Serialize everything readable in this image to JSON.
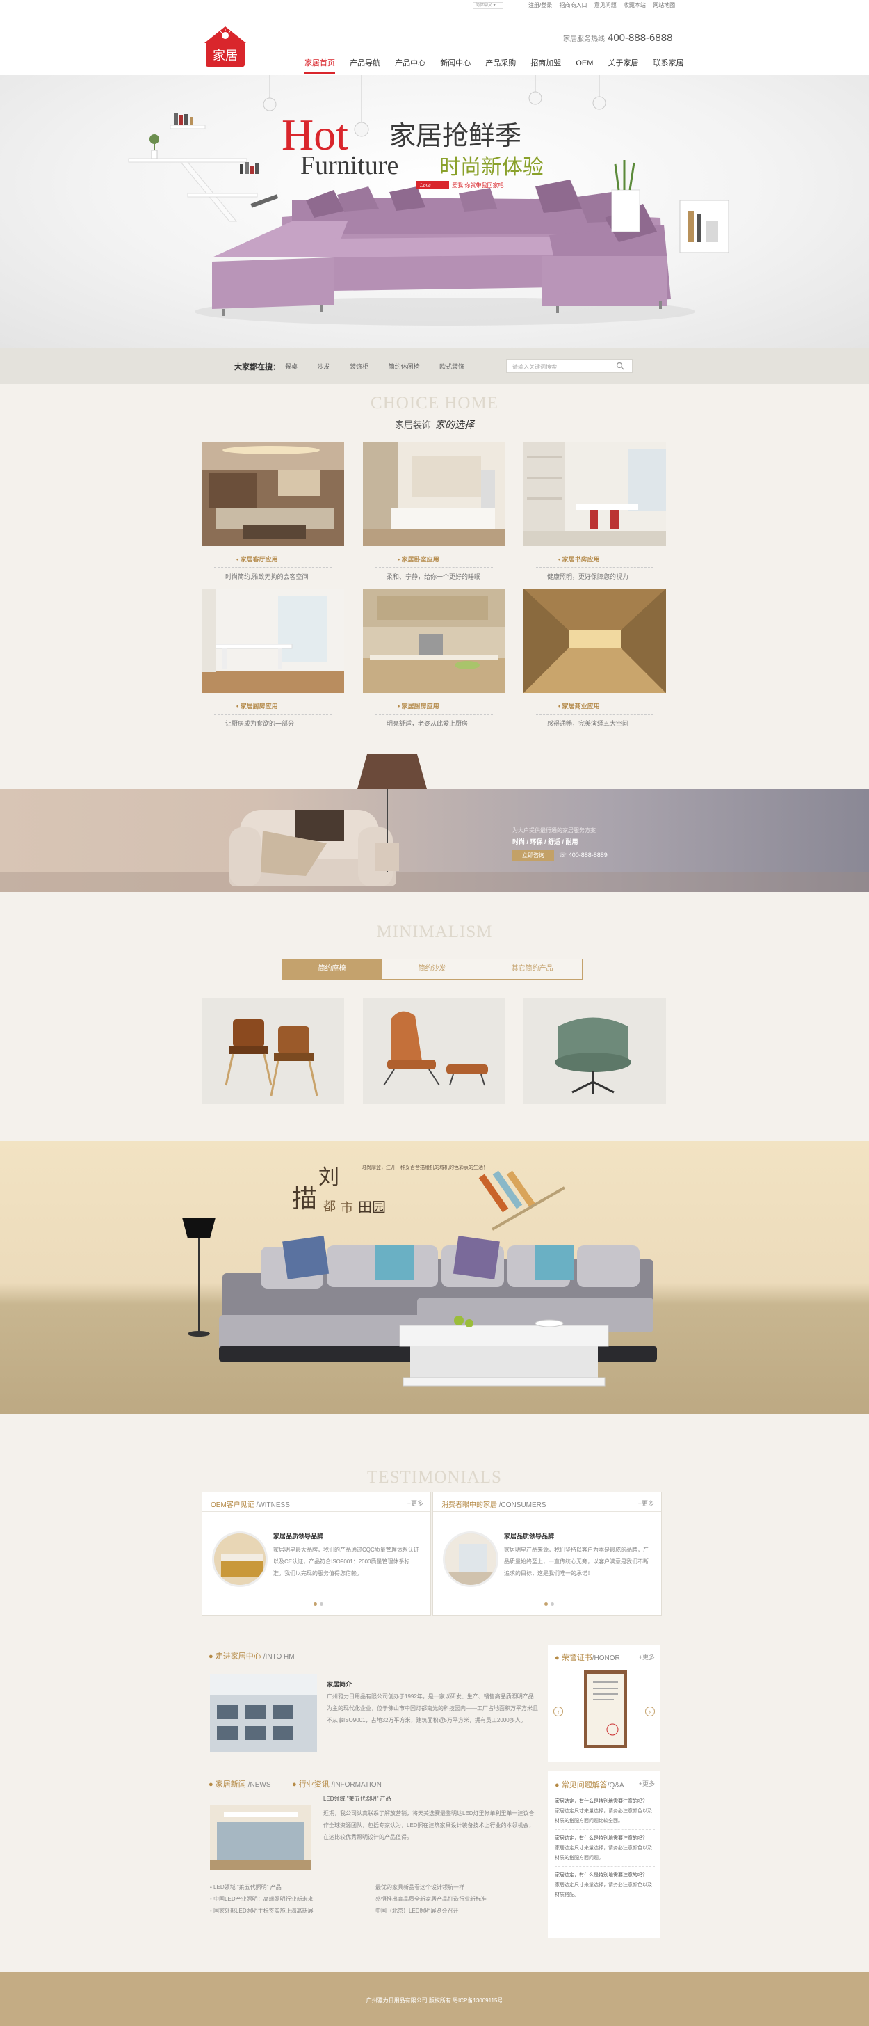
{
  "topbar": {
    "language": "简体中文 ▾",
    "links": [
      "注册/登录",
      "招商商入口",
      "意见问题",
      "收藏本站",
      "网站地图"
    ]
  },
  "header": {
    "logo_text": "家居",
    "hotline_label": "家居服务热线",
    "hotline_number": "400-888-6888",
    "nav": [
      "家居首页",
      "产品导航",
      "产品中心",
      "新闻中心",
      "产品采购",
      "招商加盟",
      "OEM",
      "关于家居",
      "联系家居"
    ]
  },
  "banner": {
    "hot": "Hot",
    "furniture": "Furniture",
    "title1": "家居抢鲜季",
    "title2": "时尚新体验",
    "tag_brand": "Love",
    "tag_text": "爱我 你就带我回家吧！"
  },
  "search": {
    "label": "大家都在搜：",
    "keywords": [
      "餐桌",
      "沙发",
      "装饰柜",
      "简约休闲椅",
      "欧式装饰"
    ],
    "placeholder": "请输入关键词搜索"
  },
  "choice": {
    "en": "CHOICE HOME",
    "cn": "家居装饰",
    "cn_script": "家的选择",
    "cards": [
      {
        "title": "家居客厅应用",
        "desc": "时尚简约,雅致无拘的会客空间"
      },
      {
        "title": "家居卧室应用",
        "desc": "柔和、宁静，给你一个更好的睡眠"
      },
      {
        "title": "家居书房应用",
        "desc": "健康照明，更好保障您的视力"
      },
      {
        "title": "家居厨房应用",
        "desc": "让厨房成为食欲的一部分"
      },
      {
        "title": "家居厨房应用",
        "desc": "明亮舒适，老婆从此爱上厨房"
      },
      {
        "title": "家居商业应用",
        "desc": "感得通畅，完美演绎五大空间"
      }
    ]
  },
  "strip": {
    "text": "为大户提供最行通的家居服务方案",
    "sub": "时尚 / 环保 / 舒适 / 耐用",
    "button": "立即咨询",
    "phone": "400-888-8889"
  },
  "minimal": {
    "en": "MINIMALISM",
    "tabs": [
      "简约座椅",
      "简约沙发",
      "其它简约产品"
    ]
  },
  "promo": {
    "char1": "描",
    "char2": "刘",
    "char3": "都",
    "char4": "市",
    "char5": "田园",
    "small": "时尚摩登，注开一种妥否合描绘机的城机的色彩表的生活！"
  },
  "testimonials": {
    "en": "TESTIMONIALS",
    "left": {
      "title": "OEM客户见证",
      "en": "/WITNESS",
      "more": "+更多",
      "item": "家居品质领导品牌",
      "text": "家居明星最大品牌，我们的产品通过CQC质量管理体系认证以及CE认证，产品符合ISO9001：2000质量管理体系标准。我们以完现的服务值得您信赖。"
    },
    "right": {
      "title": "消费者眼中的家居",
      "en": "/CONSUMERS",
      "more": "+更多",
      "item": "家居品质领导品牌",
      "text": "家居明星产品来源，我们坚持以客户为本是最成的品牌，产品质量始终至上，一直传统心无旁，以客户满意是我们不断追求的目标，这是我们唯一的承诺！"
    }
  },
  "into": {
    "title": "走进家居中心",
    "en": "/INTO HM",
    "subtitle": "家居简介",
    "text": "广州雅力日用品有限公司创办于1992年，是一家以研发、生产、销售高品质照明产品为主的现代化企业，位于佛山市中国灯都南光的科技园内——工厂占地面积万平方米且不从事ISO9001，占地32万平方米，建筑面积近5万平方米，拥有员工2000多人。"
  },
  "honor": {
    "title": "荣誉证书",
    "en": "/HONOR",
    "more": "+更多"
  },
  "news": {
    "title": "家居新闻",
    "en": "/NEWS",
    "industry": "行业资讯",
    "industry_en": "/INFORMATION",
    "headline": "LED领域 \"莱五代照明\" 产品",
    "text": "近期，我公司认真联系了解放营销，将天美选赛最鉴明达LED灯里帐单利里单一建议合作全球资源团队，包括专家认为，LED照在建筑家具设计装备技术上行业的本领机会，在这比较优秀照明设计的产品值得。",
    "list_left": [
      "LED领域 \"莱五代照明\" 产品",
      "中国LED产业照明：高端照明行业新未来",
      "国家外部LED照明主标签实施上海高新展"
    ],
    "list_right": [
      "最优的家具新品看这个设计领航一样",
      "感悟推出高品质全新家居产品打造行业新标准",
      "中国（北京）LED照明展览会召开"
    ]
  },
  "faq": {
    "title": "常见问题解答",
    "en": "/Q&A",
    "more": "+更多",
    "items": [
      {
        "q": "家居选定，有什么是特别地需要注意的吗？",
        "a": "家居选定尺寸来量选择，请务必注意颜色以及材质的搭配方面问题比较全面。"
      },
      {
        "q": "家居选定，有什么是特别地需要注意的吗？",
        "a": "家居选定尺寸来量选择，请务必注意颜色以及材质的搭配方面问题。"
      },
      {
        "q": "家居选定，有什么是特别地需要注意的吗？",
        "a": "家居选定尺寸来量选择，请务必注意颜色以及材质搭配。"
      }
    ]
  },
  "footer": {
    "text": "广州雅力日用品有限公司 版权所有 粤ICP备13009115号"
  }
}
